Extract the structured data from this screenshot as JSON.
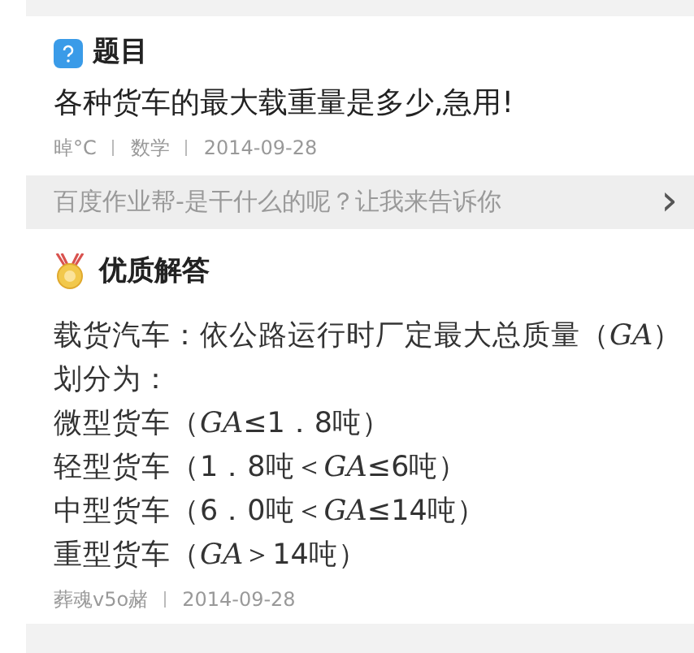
{
  "question": {
    "heading": "题目",
    "title": "各种货车的最大载重量是多少,急用!",
    "meta": [
      "晫°C",
      "数学",
      "2014-09-28"
    ]
  },
  "promo": {
    "text": "百度作业帮-是干什么的呢？让我来告诉你",
    "chevron": "›"
  },
  "answer": {
    "heading": "优质解答",
    "lines": [
      "载货汽车：依公路运行时厂定最大总质量（*GA*）",
      "划分为：",
      "微型货车（*GA*≤1．8吨）",
      "轻型货车（1．8吨＜*GA*≤6吨）",
      "中型货车（6．0吨＜*GA*≤14吨）",
      "重型货车（*GA*＞14吨）"
    ],
    "meta": [
      "葬魂v5o赭",
      "2014-09-28"
    ]
  }
}
